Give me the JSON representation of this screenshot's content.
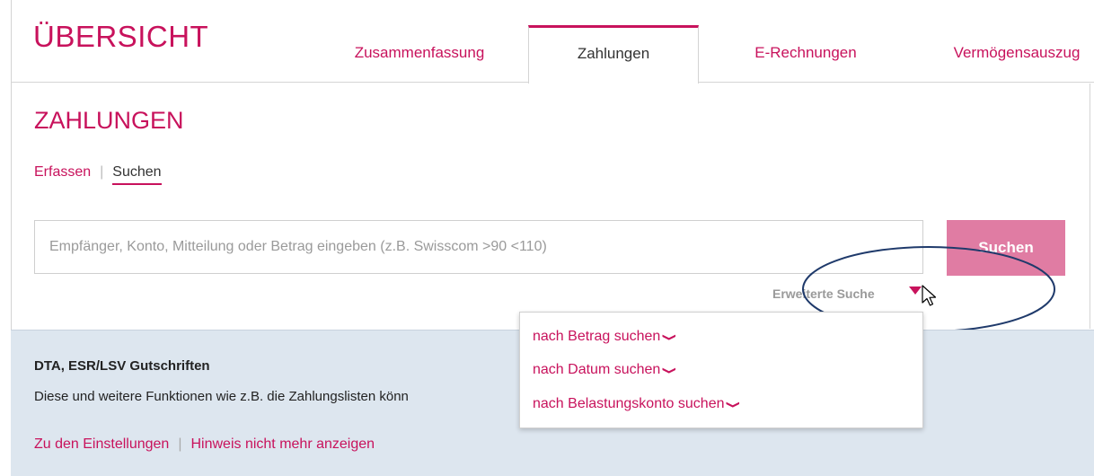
{
  "header": {
    "title": "ÜBERSICHT",
    "tabs": [
      {
        "label": "Zusammenfassung"
      },
      {
        "label": "Zahlungen"
      },
      {
        "label": "E-Rechnungen"
      },
      {
        "label": "Vermögensauszug"
      }
    ],
    "active_tab": "Zahlungen"
  },
  "main": {
    "section_title": "ZAHLUNGEN",
    "subnav": {
      "items": [
        "Erfassen",
        "Suchen"
      ],
      "active": "Suchen"
    },
    "search": {
      "placeholder": "Empfänger, Konto, Mitteilung oder Betrag eingeben (z.B. Swisscom >90 <110)",
      "value": "",
      "button_label": "Suchen"
    },
    "advanced_search_label": "Erweiterte Suche"
  },
  "dropdown": {
    "items": [
      {
        "label": "nach Betrag suchen"
      },
      {
        "label": "nach Datum suchen"
      },
      {
        "label": "nach Belastungskonto suchen"
      }
    ]
  },
  "info": {
    "title": "DTA, ESR/LSV Gutschriften",
    "text": "Diese und weitere Funktionen wie z.B. die Zahlungslisten könn",
    "links": [
      "Zu den Einstellungen",
      "Hinweis nicht mehr anzeigen"
    ]
  },
  "colors": {
    "accent": "#c8125c",
    "button": "#e07ca3",
    "info_bg": "#dde6ef",
    "annotation": "#1f3a6b"
  },
  "icons": {
    "dropdown_chevron": "chevron-down-icon",
    "advanced_arrow": "triangle-down-icon",
    "cursor": "mouse-pointer-icon"
  }
}
